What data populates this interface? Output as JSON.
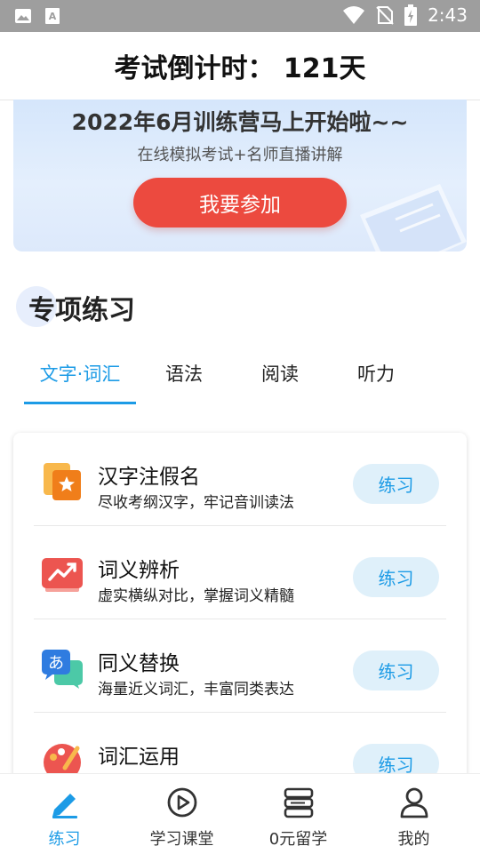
{
  "status_bar": {
    "time": "2:43",
    "icons": [
      "image-icon",
      "text-icon",
      "wifi-icon",
      "no-sim-icon",
      "battery-charging-icon"
    ]
  },
  "header": {
    "title": "考试倒计时： 121天"
  },
  "banner": {
    "title": "2022年6月训练营马上开始啦~~",
    "subtitle": "在线模拟考试+名师直播讲解",
    "button": "我要参加"
  },
  "section": {
    "title": "专项练习"
  },
  "tabs": [
    {
      "label": "文字·词汇",
      "active": true
    },
    {
      "label": "语法",
      "active": false
    },
    {
      "label": "阅读",
      "active": false
    },
    {
      "label": "听力",
      "active": false
    }
  ],
  "practice_items": [
    {
      "name": "汉字注假名",
      "desc": "尽收考纲汉字，牢记音训读法",
      "button": "练习",
      "icon": "star-book-icon"
    },
    {
      "name": "词义辨析",
      "desc": "虚实横纵对比，掌握词义精髓",
      "button": "练习",
      "icon": "trend-chart-icon"
    },
    {
      "name": "同义替换",
      "desc": "海量近义词汇，丰富同类表达",
      "button": "练习",
      "icon": "translate-icon"
    },
    {
      "name": "词汇运用",
      "desc": "",
      "button": "练习",
      "icon": "palette-icon"
    }
  ],
  "bottom_nav": [
    {
      "label": "练习",
      "icon": "pencil-icon",
      "active": true
    },
    {
      "label": "学习课堂",
      "icon": "play-circle-icon",
      "active": false
    },
    {
      "label": "0元留学",
      "icon": "books-stack-icon",
      "active": false
    },
    {
      "label": "我的",
      "icon": "user-icon",
      "active": false
    }
  ],
  "colors": {
    "accent": "#1c9be6",
    "join_button": "#ec4a3f",
    "practice_button_bg": "#dff0fa",
    "status_bar": "#9e9e9e"
  }
}
